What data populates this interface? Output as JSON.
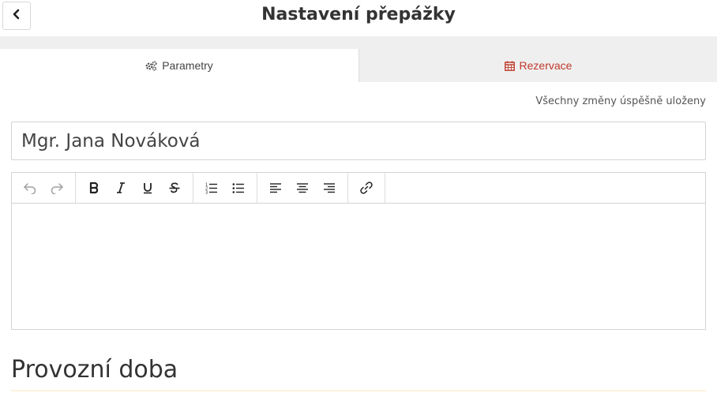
{
  "header": {
    "title": "Nastavení přepážky",
    "back_icon": "chevron-left-icon"
  },
  "tabs": [
    {
      "label": "Parametry",
      "icon": "cogs-icon",
      "active": true
    },
    {
      "label": "Rezervace",
      "icon": "calendar-icon",
      "active": false,
      "color": "#c0392b"
    }
  ],
  "status": {
    "text": "Všechny změny úspěšně uloženy"
  },
  "name_field": {
    "value": "Mgr. Jana Nováková"
  },
  "editor": {
    "toolbar_groups": [
      [
        "undo-icon",
        "redo-icon"
      ],
      [
        "bold-icon",
        "italic-icon",
        "underline-icon",
        "strikethrough-icon"
      ],
      [
        "ordered-list-icon",
        "bullet-list-icon"
      ],
      [
        "align-left-icon",
        "align-center-icon",
        "align-right-icon"
      ],
      [
        "link-icon"
      ]
    ],
    "content": ""
  },
  "section": {
    "title": "Provozní doba"
  },
  "colors": {
    "accent_red": "#c0392b",
    "tab_bg": "#efefef",
    "border": "#d4d4d4"
  }
}
